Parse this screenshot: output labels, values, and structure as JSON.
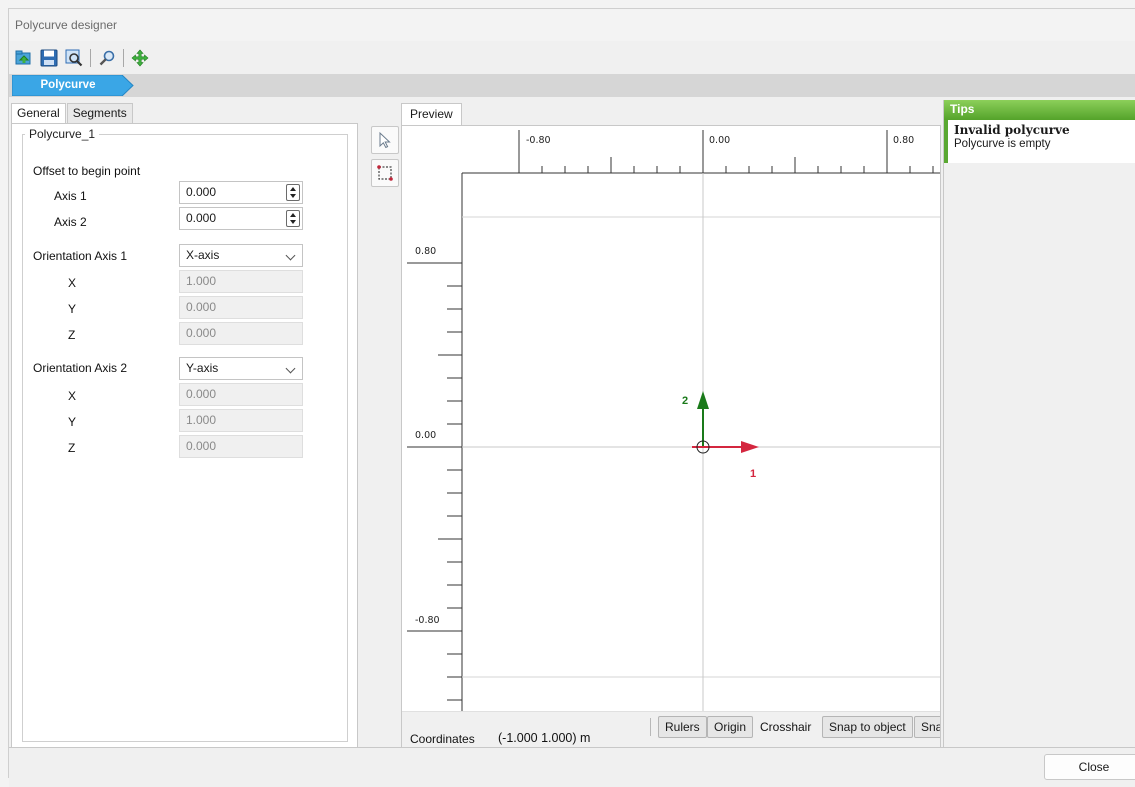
{
  "window": {
    "title": "Polycurve designer"
  },
  "toolbar": {
    "buttons": [
      {
        "icon": "open-file-icon"
      },
      {
        "icon": "save-icon"
      },
      {
        "icon": "zoom-region-icon"
      },
      {
        "icon": "zoom-icon"
      },
      {
        "icon": "pan-move-icon"
      }
    ]
  },
  "breadcrumb": {
    "label": "Polycurve",
    "color": "#3aa6e6"
  },
  "tabs": {
    "general": "General",
    "segments": "Segments",
    "active": "General"
  },
  "general": {
    "group_title": "Polycurve_1",
    "offset_label": "Offset to begin point",
    "axis1_label": "Axis 1",
    "axis1_value": "0.000",
    "axis2_label": "Axis 2",
    "axis2_value": "0.000",
    "orient1_label": "Orientation Axis 1",
    "orient1_value": "X-axis",
    "orient1": {
      "x_label": "X",
      "x": "1.000",
      "y_label": "Y",
      "y": "0.000",
      "z_label": "Z",
      "z": "0.000"
    },
    "orient2_label": "Orientation Axis 2",
    "orient2_value": "Y-axis",
    "orient2": {
      "x_label": "X",
      "x": "0.000",
      "y_label": "Y",
      "y": "1.000",
      "z_label": "Z",
      "z": "0.000"
    }
  },
  "side_tools": [
    {
      "icon": "select-arrow-icon"
    },
    {
      "icon": "rectangle-select-icon"
    }
  ],
  "preview": {
    "tab_label": "Preview",
    "ruler_top_labels": [
      "-0.80",
      "0.00",
      "0.80"
    ],
    "ruler_left_labels": [
      "0.80",
      "0.00",
      "-0.80"
    ],
    "axis1_label": "1",
    "axis2_label": "2",
    "axis1_color": "#d4263f",
    "axis2_color": "#1a7a1a"
  },
  "statusbar": {
    "coordinates_label": "Coordinates",
    "coordinates_value": "(-1.000 1.000) m",
    "rulers": "Rulers",
    "origin": "Origin",
    "crosshair": "Crosshair",
    "snap_object": "Snap to object",
    "snap_more": "Sna"
  },
  "tips": {
    "header": "Tips",
    "title": "Invalid polycurve",
    "message": "Polycurve is empty",
    "accent": "#5aa832"
  },
  "footer": {
    "close_label": "Close"
  }
}
